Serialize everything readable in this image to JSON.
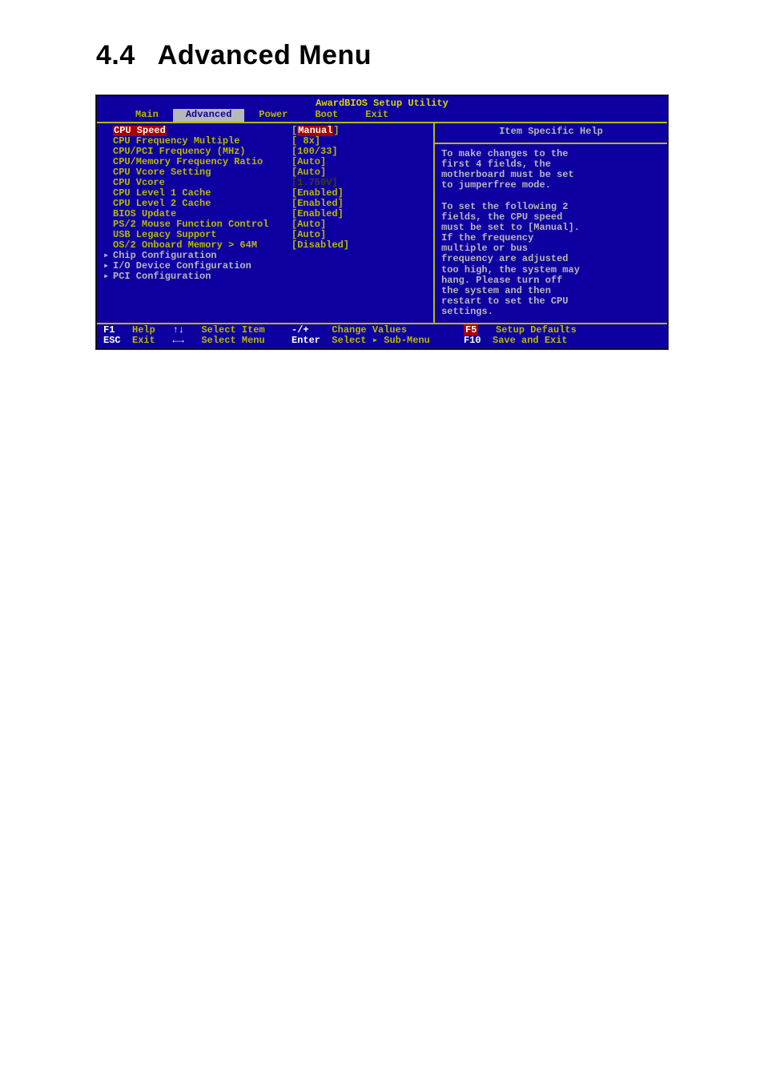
{
  "heading": {
    "num": "4.4",
    "title": "Advanced Menu"
  },
  "bios": {
    "title": "AwardBIOS Setup Utility",
    "tabs": [
      "Main",
      "Advanced",
      "Power",
      "Boot",
      "Exit"
    ],
    "activeTab": 1,
    "items": [
      {
        "label": "CPU Speed",
        "value": "Manual",
        "selected": true,
        "submenu": false,
        "brackets": "highlight"
      },
      {
        "label": "CPU Frequency Multiple",
        "value": "[ 8x]",
        "submenu": false
      },
      {
        "label": "CPU/PCI Frequency (MHz)",
        "value": "[100/33]",
        "submenu": false
      },
      {
        "label": "CPU/Memory Frequency Ratio",
        "value": "[Auto]",
        "submenu": false
      },
      {
        "label": "CPU Vcore Setting",
        "value": "[Auto]",
        "submenu": false
      },
      {
        "label": "CPU Vcore",
        "value": "[1.750V]",
        "dim": true,
        "submenu": false
      },
      {
        "label": "CPU Level 1 Cache",
        "value": "[Enabled]",
        "submenu": false
      },
      {
        "label": "CPU Level 2 Cache",
        "value": "[Enabled]",
        "submenu": false
      },
      {
        "label": "BIOS Update",
        "value": "[Enabled]",
        "submenu": false
      },
      {
        "label": "PS/2 Mouse Function Control",
        "value": "[Auto]",
        "submenu": false
      },
      {
        "label": "USB Legacy Support",
        "value": "[Auto]",
        "submenu": false
      },
      {
        "label": "OS/2 Onboard Memory > 64M",
        "value": "[Disabled]",
        "submenu": false
      },
      {
        "label": "Chip Configuration",
        "value": "",
        "submenu": true
      },
      {
        "label": "I/O Device Configuration",
        "value": "",
        "submenu": true
      },
      {
        "label": "PCI Configuration",
        "value": "",
        "submenu": true
      }
    ],
    "help": {
      "title": "Item Specific Help",
      "body": "To make changes to the\nfirst 4 fields, the\nmotherboard must be set\nto jumperfree mode.\n\nTo set the following 2\nfields, the CPU speed\nmust be set to [Manual].\nIf the frequency\nmultiple or bus\nfrequency are adjusted\ntoo high, the system may\nhang. Please turn off\nthe system and then\nrestart to set the CPU\nsettings."
    },
    "legend": {
      "r1": {
        "k1": "F1",
        "a1": "Help",
        "k2": "↑↓",
        "a2": "Select Item",
        "k3": "-/+",
        "a3": "Change Values",
        "k4": "F5",
        "a4": "Setup Defaults"
      },
      "r2": {
        "k1": "ESC",
        "a1": "Exit",
        "k2": "←→",
        "a2": "Select Menu",
        "k3": "Enter",
        "a3": "Select ▸ Sub-Menu",
        "k4": "F10",
        "a4": "Save and Exit"
      }
    }
  }
}
